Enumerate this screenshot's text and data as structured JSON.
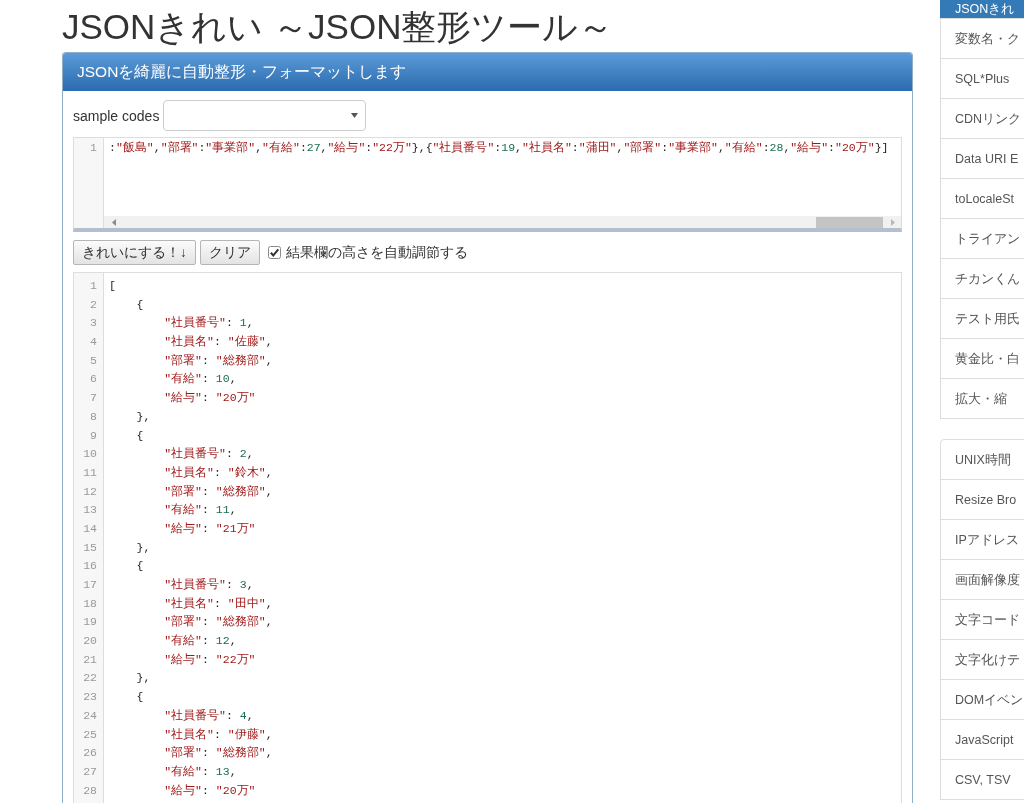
{
  "page_title": "JSONきれい ～JSON整形ツール～",
  "panel": {
    "heading": "JSONを綺麗に自動整形・フォーマットします",
    "sample_codes": {
      "label": "sample codes"
    },
    "input_editor": {
      "lines": [
        {
          "number": "1",
          "tokens": [
            {
              "kind": "punct",
              "text": ":"
            },
            {
              "kind": "string",
              "text": "\"飯島\""
            },
            {
              "kind": "punct",
              "text": ","
            },
            {
              "kind": "string",
              "text": "\"部署\""
            },
            {
              "kind": "punct",
              "text": ":"
            },
            {
              "kind": "string",
              "text": "\"事業部\""
            },
            {
              "kind": "punct",
              "text": ","
            },
            {
              "kind": "string",
              "text": "\"有給\""
            },
            {
              "kind": "punct",
              "text": ":"
            },
            {
              "kind": "number",
              "text": "27"
            },
            {
              "kind": "punct",
              "text": ","
            },
            {
              "kind": "string",
              "text": "\"給与\""
            },
            {
              "kind": "punct",
              "text": ":"
            },
            {
              "kind": "string",
              "text": "\"22万\""
            },
            {
              "kind": "punct",
              "text": "},{"
            },
            {
              "kind": "string",
              "text": "\"社員番号\""
            },
            {
              "kind": "punct",
              "text": ":"
            },
            {
              "kind": "number",
              "text": "19"
            },
            {
              "kind": "punct",
              "text": ","
            },
            {
              "kind": "string",
              "text": "\"社員名\""
            },
            {
              "kind": "punct",
              "text": ":"
            },
            {
              "kind": "string",
              "text": "\"蒲田\""
            },
            {
              "kind": "punct",
              "text": ","
            },
            {
              "kind": "string",
              "text": "\"部署\""
            },
            {
              "kind": "punct",
              "text": ":"
            },
            {
              "kind": "string",
              "text": "\"事業部\""
            },
            {
              "kind": "punct",
              "text": ","
            },
            {
              "kind": "string",
              "text": "\"有給\""
            },
            {
              "kind": "punct",
              "text": ":"
            },
            {
              "kind": "number",
              "text": "28"
            },
            {
              "kind": "punct",
              "text": ","
            },
            {
              "kind": "string",
              "text": "\"給与\""
            },
            {
              "kind": "punct",
              "text": ":"
            },
            {
              "kind": "string",
              "text": "\"20万\""
            },
            {
              "kind": "punct",
              "text": "}]"
            }
          ]
        }
      ]
    },
    "buttons": [
      "きれいにする！↓",
      "クリア"
    ],
    "auto_height": {
      "label": "結果欄の高さを自動調節する",
      "checked": true
    },
    "output_editor": {
      "lines": [
        {
          "number": "1",
          "tokens": [
            {
              "kind": "punct",
              "text": "["
            }
          ]
        },
        {
          "number": "2",
          "tokens": [
            {
              "kind": "punct",
              "text": "    {"
            }
          ]
        },
        {
          "number": "3",
          "tokens": [
            {
              "kind": "string",
              "text": "        \"社員番号\""
            },
            {
              "kind": "punct",
              "text": ": "
            },
            {
              "kind": "number",
              "text": "1"
            },
            {
              "kind": "punct",
              "text": ","
            }
          ]
        },
        {
          "number": "4",
          "tokens": [
            {
              "kind": "string",
              "text": "        \"社員名\""
            },
            {
              "kind": "punct",
              "text": ": "
            },
            {
              "kind": "string",
              "text": "\"佐藤\""
            },
            {
              "kind": "punct",
              "text": ","
            }
          ]
        },
        {
          "number": "5",
          "tokens": [
            {
              "kind": "string",
              "text": "        \"部署\""
            },
            {
              "kind": "punct",
              "text": ": "
            },
            {
              "kind": "string",
              "text": "\"総務部\""
            },
            {
              "kind": "punct",
              "text": ","
            }
          ]
        },
        {
          "number": "6",
          "tokens": [
            {
              "kind": "string",
              "text": "        \"有給\""
            },
            {
              "kind": "punct",
              "text": ": "
            },
            {
              "kind": "number",
              "text": "10"
            },
            {
              "kind": "punct",
              "text": ","
            }
          ]
        },
        {
          "number": "7",
          "tokens": [
            {
              "kind": "string",
              "text": "        \"給与\""
            },
            {
              "kind": "punct",
              "text": ": "
            },
            {
              "kind": "string",
              "text": "\"20万\""
            }
          ]
        },
        {
          "number": "8",
          "tokens": [
            {
              "kind": "punct",
              "text": "    },"
            }
          ]
        },
        {
          "number": "9",
          "tokens": [
            {
              "kind": "punct",
              "text": "    {"
            }
          ]
        },
        {
          "number": "10",
          "tokens": [
            {
              "kind": "string",
              "text": "        \"社員番号\""
            },
            {
              "kind": "punct",
              "text": ": "
            },
            {
              "kind": "number",
              "text": "2"
            },
            {
              "kind": "punct",
              "text": ","
            }
          ]
        },
        {
          "number": "11",
          "tokens": [
            {
              "kind": "string",
              "text": "        \"社員名\""
            },
            {
              "kind": "punct",
              "text": ": "
            },
            {
              "kind": "string",
              "text": "\"鈴木\""
            },
            {
              "kind": "punct",
              "text": ","
            }
          ]
        },
        {
          "number": "12",
          "tokens": [
            {
              "kind": "string",
              "text": "        \"部署\""
            },
            {
              "kind": "punct",
              "text": ": "
            },
            {
              "kind": "string",
              "text": "\"総務部\""
            },
            {
              "kind": "punct",
              "text": ","
            }
          ]
        },
        {
          "number": "13",
          "tokens": [
            {
              "kind": "string",
              "text": "        \"有給\""
            },
            {
              "kind": "punct",
              "text": ": "
            },
            {
              "kind": "number",
              "text": "11"
            },
            {
              "kind": "punct",
              "text": ","
            }
          ]
        },
        {
          "number": "14",
          "tokens": [
            {
              "kind": "string",
              "text": "        \"給与\""
            },
            {
              "kind": "punct",
              "text": ": "
            },
            {
              "kind": "string",
              "text": "\"21万\""
            }
          ]
        },
        {
          "number": "15",
          "tokens": [
            {
              "kind": "punct",
              "text": "    },"
            }
          ]
        },
        {
          "number": "16",
          "tokens": [
            {
              "kind": "punct",
              "text": "    {"
            }
          ]
        },
        {
          "number": "17",
          "tokens": [
            {
              "kind": "string",
              "text": "        \"社員番号\""
            },
            {
              "kind": "punct",
              "text": ": "
            },
            {
              "kind": "number",
              "text": "3"
            },
            {
              "kind": "punct",
              "text": ","
            }
          ]
        },
        {
          "number": "18",
          "tokens": [
            {
              "kind": "string",
              "text": "        \"社員名\""
            },
            {
              "kind": "punct",
              "text": ": "
            },
            {
              "kind": "string",
              "text": "\"田中\""
            },
            {
              "kind": "punct",
              "text": ","
            }
          ]
        },
        {
          "number": "19",
          "tokens": [
            {
              "kind": "string",
              "text": "        \"部署\""
            },
            {
              "kind": "punct",
              "text": ": "
            },
            {
              "kind": "string",
              "text": "\"総務部\""
            },
            {
              "kind": "punct",
              "text": ","
            }
          ]
        },
        {
          "number": "20",
          "tokens": [
            {
              "kind": "string",
              "text": "        \"有給\""
            },
            {
              "kind": "punct",
              "text": ": "
            },
            {
              "kind": "number",
              "text": "12"
            },
            {
              "kind": "punct",
              "text": ","
            }
          ]
        },
        {
          "number": "21",
          "tokens": [
            {
              "kind": "string",
              "text": "        \"給与\""
            },
            {
              "kind": "punct",
              "text": ": "
            },
            {
              "kind": "string",
              "text": "\"22万\""
            }
          ]
        },
        {
          "number": "22",
          "tokens": [
            {
              "kind": "punct",
              "text": "    },"
            }
          ]
        },
        {
          "number": "23",
          "tokens": [
            {
              "kind": "punct",
              "text": "    {"
            }
          ]
        },
        {
          "number": "24",
          "tokens": [
            {
              "kind": "string",
              "text": "        \"社員番号\""
            },
            {
              "kind": "punct",
              "text": ": "
            },
            {
              "kind": "number",
              "text": "4"
            },
            {
              "kind": "punct",
              "text": ","
            }
          ]
        },
        {
          "number": "25",
          "tokens": [
            {
              "kind": "string",
              "text": "        \"社員名\""
            },
            {
              "kind": "punct",
              "text": ": "
            },
            {
              "kind": "string",
              "text": "\"伊藤\""
            },
            {
              "kind": "punct",
              "text": ","
            }
          ]
        },
        {
          "number": "26",
          "tokens": [
            {
              "kind": "string",
              "text": "        \"部署\""
            },
            {
              "kind": "punct",
              "text": ": "
            },
            {
              "kind": "string",
              "text": "\"総務部\""
            },
            {
              "kind": "punct",
              "text": ","
            }
          ]
        },
        {
          "number": "27",
          "tokens": [
            {
              "kind": "string",
              "text": "        \"有給\""
            },
            {
              "kind": "punct",
              "text": ": "
            },
            {
              "kind": "number",
              "text": "13"
            },
            {
              "kind": "punct",
              "text": ","
            }
          ]
        },
        {
          "number": "28",
          "tokens": [
            {
              "kind": "string",
              "text": "        \"給与\""
            },
            {
              "kind": "punct",
              "text": ": "
            },
            {
              "kind": "string",
              "text": "\"20万\""
            }
          ]
        }
      ]
    }
  },
  "sidebar": {
    "groups": [
      {
        "items": [
          {
            "label": "JSONきれ",
            "selected": true
          },
          {
            "label": "変数名・ク",
            "selected": false
          },
          {
            "label": "SQL*Plus",
            "selected": false
          },
          {
            "label": "CDNリンク",
            "selected": false
          },
          {
            "label": "Data URI E",
            "selected": false
          },
          {
            "label": "toLocaleSt",
            "selected": false
          },
          {
            "label": "トライアン",
            "selected": false
          },
          {
            "label": "チカンくん",
            "selected": false
          },
          {
            "label": "テスト用氏",
            "selected": false
          },
          {
            "label": "黄金比・白",
            "selected": false
          },
          {
            "label": "拡大・縮",
            "selected": false
          }
        ]
      },
      {
        "items": [
          {
            "label": "UNIX時間",
            "selected": false
          },
          {
            "label": "Resize Bro",
            "selected": false
          },
          {
            "label": "IPアドレス",
            "selected": false
          },
          {
            "label": "画面解像度",
            "selected": false
          },
          {
            "label": "文字コード",
            "selected": false
          },
          {
            "label": "文字化けテ",
            "selected": false
          },
          {
            "label": "DOMイベン",
            "selected": false
          },
          {
            "label": "JavaScript",
            "selected": false
          },
          {
            "label": "CSV, TSV",
            "selected": false
          }
        ]
      }
    ]
  }
}
